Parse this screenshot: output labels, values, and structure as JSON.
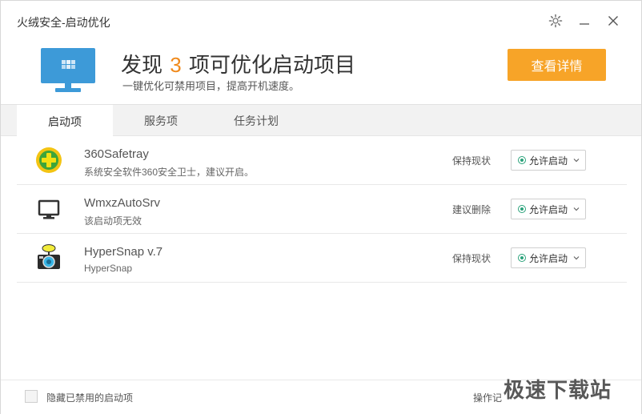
{
  "window": {
    "title": "火绒安全-启动优化"
  },
  "header": {
    "headline_prefix": "发现",
    "count": "3",
    "headline_suffix": "项可优化启动项目",
    "subline": "一键优化可禁用项目，提高开机速度。",
    "detail_button": "查看详情"
  },
  "tabs": [
    {
      "label": "启动项",
      "active": true
    },
    {
      "label": "服务项",
      "active": false
    },
    {
      "label": "任务计划",
      "active": false
    }
  ],
  "items": [
    {
      "icon": "360-safe-icon",
      "name": "360Safetray",
      "desc": "系统安全软件360安全卫士，建议开启。",
      "status": "保持现状",
      "action": "允许启动"
    },
    {
      "icon": "monitor-icon",
      "name": "WmxzAutoSrv",
      "desc": "该启动项无效",
      "status": "建议删除",
      "action": "允许启动"
    },
    {
      "icon": "camera-icon",
      "name": "HyperSnap v.7",
      "desc": "HyperSnap",
      "status": "保持现状",
      "action": "允许启动"
    }
  ],
  "footer": {
    "hide_disabled_label": "隐藏已禁用的启动项",
    "ops_link": "操作记"
  },
  "watermark": "极速下载站",
  "colors": {
    "accent_orange": "#f7a428",
    "count_orange": "#f08a1c",
    "radio_green": "#2aa27a",
    "monitor_blue": "#3d9ad8"
  }
}
